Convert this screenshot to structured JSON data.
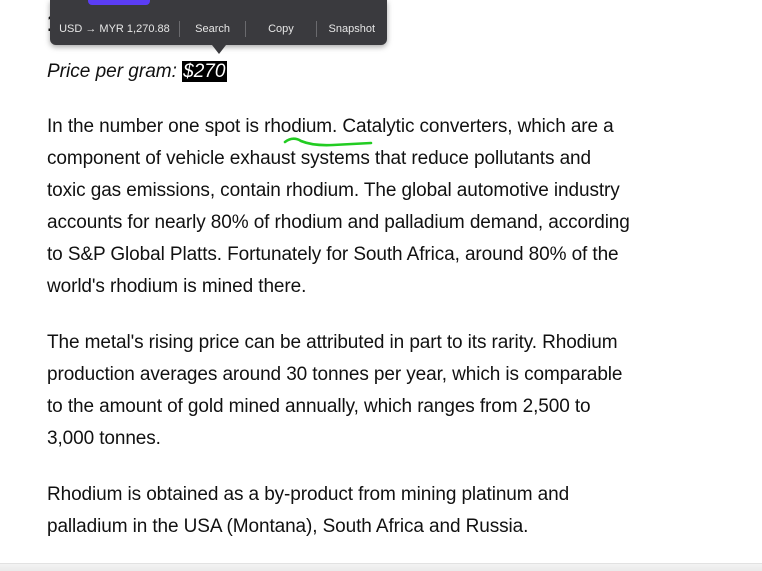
{
  "selection_toolbar": {
    "currency_conversion": "USD → MYR 1,270.88",
    "search_label": "Search",
    "copy_label": "Copy",
    "snapshot_label": "Snapshot",
    "accent_color": "#5b3df5",
    "background_color": "#3a3a3e"
  },
  "article": {
    "heading_fragment": "1",
    "price_label": "Price per gram: ",
    "price_value": "$270",
    "underlined_word": "rhodium",
    "underline_color": "#22cc22",
    "paragraph_1": [
      "In the number one spot is rhodium. Catalytic converters, which are a",
      "component of vehicle exhaust systems that reduce pollutants and",
      "toxic gas emissions, contain rhodium. The global automotive industry",
      "accounts for nearly 80% of rhodium and palladium demand, according",
      "to S&P Global Platts. Fortunately for South Africa, around 80% of the",
      "world's rhodium is mined there."
    ],
    "paragraph_2": [
      "The metal's rising price can be attributed in part to its rarity. Rhodium",
      "production averages around 30 tonnes per year, which is comparable",
      "to the amount of gold mined annually, which ranges from 2,500 to",
      "3,000 tonnes."
    ],
    "paragraph_3": [
      "Rhodium is obtained as a by-product from mining platinum and",
      "palladium in the USA (Montana), South Africa and Russia."
    ]
  }
}
